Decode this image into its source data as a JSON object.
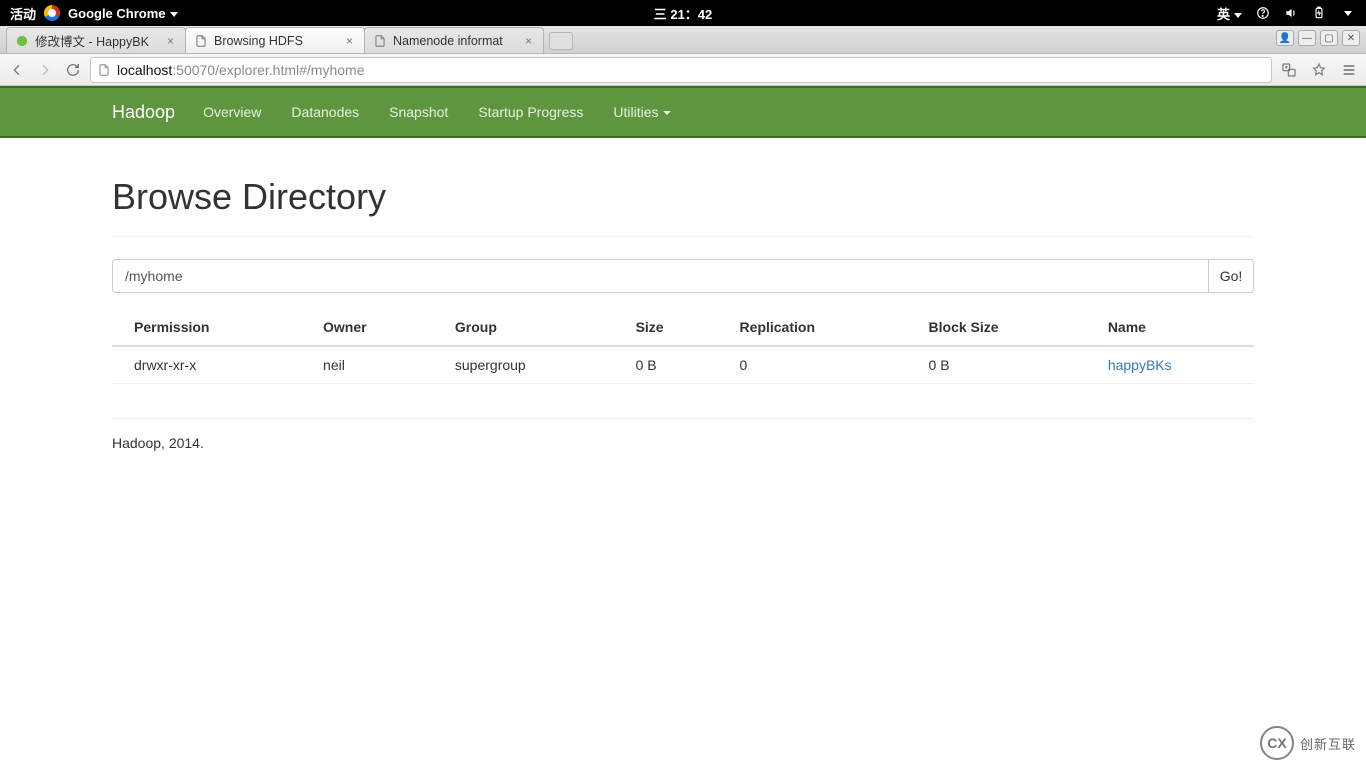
{
  "os_bar": {
    "activities": "活动",
    "app": "Google Chrome",
    "clock": "三 21：42",
    "ime": "英"
  },
  "browser": {
    "tabs": [
      {
        "title": "修改博文 - HappyBK",
        "active": false
      },
      {
        "title": "Browsing HDFS",
        "active": true
      },
      {
        "title": "Namenode informat",
        "active": false
      }
    ],
    "url_host": "localhost",
    "url_rest": ":50070/explorer.html#/myhome",
    "window_buttons": {
      "user": "👤",
      "min": "—",
      "max": "▢",
      "close": "✕"
    }
  },
  "nav": {
    "brand": "Hadoop",
    "items": [
      "Overview",
      "Datanodes",
      "Snapshot",
      "Startup Progress",
      "Utilities"
    ]
  },
  "page": {
    "heading": "Browse Directory",
    "path_value": "/myhome",
    "go_label": "Go!",
    "columns": [
      "Permission",
      "Owner",
      "Group",
      "Size",
      "Replication",
      "Block Size",
      "Name"
    ],
    "rows": [
      {
        "permission": "drwxr-xr-x",
        "owner": "neil",
        "group": "supergroup",
        "size": "0 B",
        "replication": "0",
        "block_size": "0 B",
        "name": "happyBKs"
      }
    ],
    "footer": "Hadoop, 2014."
  },
  "watermark": {
    "logo": "CX",
    "text": "创新互联"
  }
}
